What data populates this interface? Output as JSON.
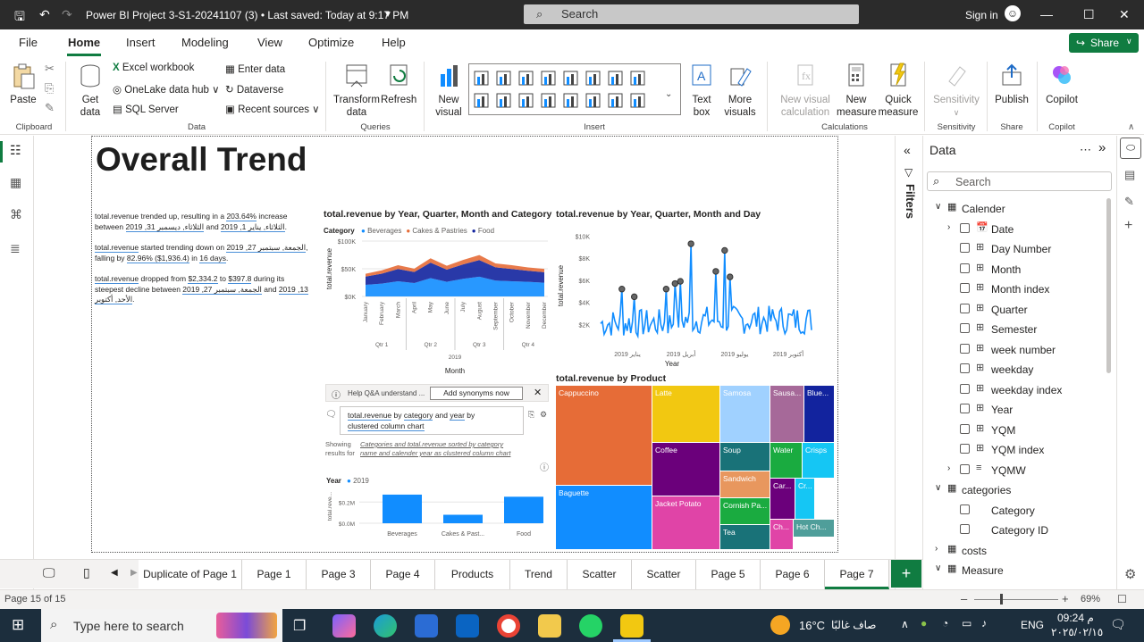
{
  "titlebar": {
    "title": "Power BI Project 3-S1-20241107 (3) • Last saved: Today at 9:17 PM",
    "search_placeholder": "Search",
    "signin": "Sign in"
  },
  "menu": {
    "tabs": [
      "File",
      "Home",
      "Insert",
      "Modeling",
      "View",
      "Optimize",
      "Help"
    ],
    "active": "Home",
    "share": "Share"
  },
  "ribbon": {
    "paste": "Paste",
    "get_data": "Get data",
    "excel": "Excel workbook",
    "onelake": "OneLake data hub",
    "sql": "SQL Server",
    "enter_data": "Enter data",
    "dataverse": "Dataverse",
    "recent": "Recent sources",
    "transform": "Transform data",
    "refresh": "Refresh",
    "new_visual": "New visual",
    "text_box": "Text box",
    "more_visuals": "More visuals",
    "new_visual_calc": "New visual calculation",
    "new_measure": "New measure",
    "quick_measure": "Quick measure",
    "sensitivity": "Sensitivity",
    "publish": "Publish",
    "copilot": "Copilot",
    "groups": {
      "clipboard": "Clipboard",
      "data": "Data",
      "queries": "Queries",
      "insert": "Insert",
      "calculations": "Calculations",
      "sensitivity": "Sensitivity",
      "share": "Share",
      "copilot": "Copilot"
    }
  },
  "report": {
    "heading": "Overall Trend",
    "narrative": [
      {
        "parts": [
          "total.revenue trended up, resulting in a ",
          "203.64%",
          " increase between ",
          "2019 ,31 الثلاثاء, ديسمبر",
          " and ",
          "2019 ,1 الثلاثاء, يناير",
          "."
        ]
      },
      {
        "parts": [
          "total.revenue",
          " started trending down on ",
          "2019 ,27 الجمعة, سبتمبر",
          ", falling by ",
          "82.96% ($1,936.4)",
          " in ",
          "16 days",
          "."
        ]
      },
      {
        "parts": [
          "total.revenue",
          " dropped from ",
          "$2,334.2",
          " to ",
          "$397.8",
          " during its steepest decline between ",
          "2019 ,27 الجمعة, سبتمبر",
          " and ",
          "2019 ,13 الأحد, أكتوبر",
          "."
        ]
      }
    ],
    "visual1": {
      "title": "total.revenue by Year, Quarter, Month and Category",
      "legend_title": "Category",
      "xlabel": "Month",
      "ylabel": "total.revenue",
      "year": "2019",
      "quarters": [
        "Qtr 1",
        "Qtr 2",
        "Qtr 3",
        "Qtr 4"
      ]
    },
    "visual2": {
      "title": "total.revenue by Year, Quarter, Month and Day",
      "xlabel": "Year",
      "ylabel": "total.revenue",
      "xticks": [
        "يناير 2019",
        "أبريل 2019",
        "يوليو 2019",
        "أكتوبر 2019"
      ]
    },
    "qa": {
      "help": "Help Q&A understand ...",
      "synonyms": "Add synonyms now",
      "question_a": "total.revenue",
      "question_b": " by ",
      "question_c": "category",
      "question_d": " and ",
      "question_e": "year",
      "question_f": " by",
      "question_g": "clustered column chart",
      "showing1": "Showing",
      "showing2": "results for",
      "result1": "Categories and total.revenue sorted by category",
      "result2": "name and calender year as clustered column chart",
      "legend_title": "Year",
      "legend_item": "2019",
      "ylabel": "total.reve..."
    },
    "treemap_title": "total.revenue by Product"
  },
  "chart_data": [
    {
      "type": "area",
      "title": "total.revenue by Year, Quarter, Month and Category",
      "xlabel": "Month",
      "ylabel": "total.revenue",
      "categories": [
        "January",
        "February",
        "March",
        "April",
        "May",
        "June",
        "July",
        "August",
        "September",
        "October",
        "November",
        "December"
      ],
      "yticks": [
        "$0K",
        "$50K",
        "$100K"
      ],
      "ylim": [
        0,
        100000
      ],
      "series": [
        {
          "name": "Beverages",
          "color": "#118dff",
          "values": [
            38000,
            42000,
            50000,
            44000,
            60000,
            48000,
            58000,
            65000,
            52000,
            50000,
            48000,
            45000
          ]
        },
        {
          "name": "Cakes & Pastries",
          "color": "#e66c37",
          "values": [
            5000,
            6000,
            7000,
            6000,
            8000,
            7000,
            8000,
            9000,
            7000,
            7000,
            6000,
            6000
          ]
        },
        {
          "name": "Food",
          "color": "#12239e",
          "values": [
            15000,
            18000,
            22000,
            20000,
            28000,
            22000,
            26000,
            30000,
            24000,
            22000,
            20000,
            19000
          ]
        }
      ]
    },
    {
      "type": "line",
      "title": "total.revenue by Year, Quarter, Month and Day",
      "xlabel": "Year",
      "ylabel": "total.revenue",
      "yticks": [
        "$2K",
        "$4K",
        "$6K",
        "$8K",
        "$10K"
      ],
      "ylim": [
        0,
        11000
      ],
      "x": [
        "يناير 2019",
        "أبريل 2019",
        "يوليو 2019",
        "أكتوبر 2019"
      ],
      "peaks": [
        5200,
        4500,
        5200,
        5700,
        5900,
        9300,
        6800,
        8700,
        6300
      ]
    },
    {
      "type": "bar",
      "title": "Q&A",
      "categories": [
        "Beverages",
        "Cakes & Past...",
        "Food"
      ],
      "yticks": [
        "$0.0M",
        "$0.2M"
      ],
      "ylim": [
        0,
        0.32
      ],
      "series": [
        {
          "name": "2019",
          "values": [
            0.27,
            0.08,
            0.25
          ]
        }
      ]
    },
    {
      "type": "treemap",
      "title": "total.revenue by Product",
      "items": [
        {
          "label": "Cappuccino",
          "color": "#e66c37"
        },
        {
          "label": "Baguette",
          "color": "#118dff"
        },
        {
          "label": "Latte",
          "color": "#f2c811"
        },
        {
          "label": "Coffee",
          "color": "#6b007b"
        },
        {
          "label": "Jacket Potato",
          "color": "#e044a7"
        },
        {
          "label": "Samosa",
          "color": "#a0d1ff"
        },
        {
          "label": "Sausa...",
          "color": "#a66999"
        },
        {
          "label": "Blue...",
          "color": "#12239e"
        },
        {
          "label": "Soup",
          "color": "#197278"
        },
        {
          "label": "Water",
          "color": "#1aab40"
        },
        {
          "label": "Crisps",
          "color": "#15c6f4"
        },
        {
          "label": "Sandwich",
          "color": "#e8975e"
        },
        {
          "label": "Cornish Pa...",
          "color": "#1aab40"
        },
        {
          "label": "Tea",
          "color": "#197278"
        },
        {
          "label": "Car...",
          "color": "#6b007b"
        },
        {
          "label": "Cr...",
          "color": "#15c6f4"
        },
        {
          "label": "Ch...",
          "color": "#e044a7"
        },
        {
          "label": "Hot Ch...",
          "color": "#4f9e9a"
        }
      ]
    }
  ],
  "filters_label": "Filters",
  "data_pane": {
    "title": "Data",
    "search_placeholder": "Search",
    "calender": "Calender",
    "fields": [
      "Date",
      "Day Number",
      "Month",
      "Month index",
      "Quarter",
      "Semester",
      "week number",
      "weekday",
      "weekday index",
      "Year",
      "YQM",
      "YQM index",
      "YQMW"
    ],
    "categories": "categories",
    "cat_fields": [
      "Category",
      "Category ID"
    ],
    "costs": "costs",
    "measure": "Measure"
  },
  "page_tabs": [
    "Duplicate of Page 1",
    "Page 1",
    "Page 3",
    "Page 4",
    "Products",
    "Trend",
    "Scatter",
    "Scatter",
    "Page 5",
    "Page 6",
    "Page 7"
  ],
  "active_tab": "Page 7",
  "status": {
    "page": "Page 15 of 15",
    "zoom": "69%"
  },
  "taskbar": {
    "search": "Type here to search",
    "temp": "16°C",
    "weather": "صاف غالبًا",
    "lang": "ENG",
    "time": "09:24 م",
    "date": "٢٠٢٥/٠٢/١٥"
  }
}
